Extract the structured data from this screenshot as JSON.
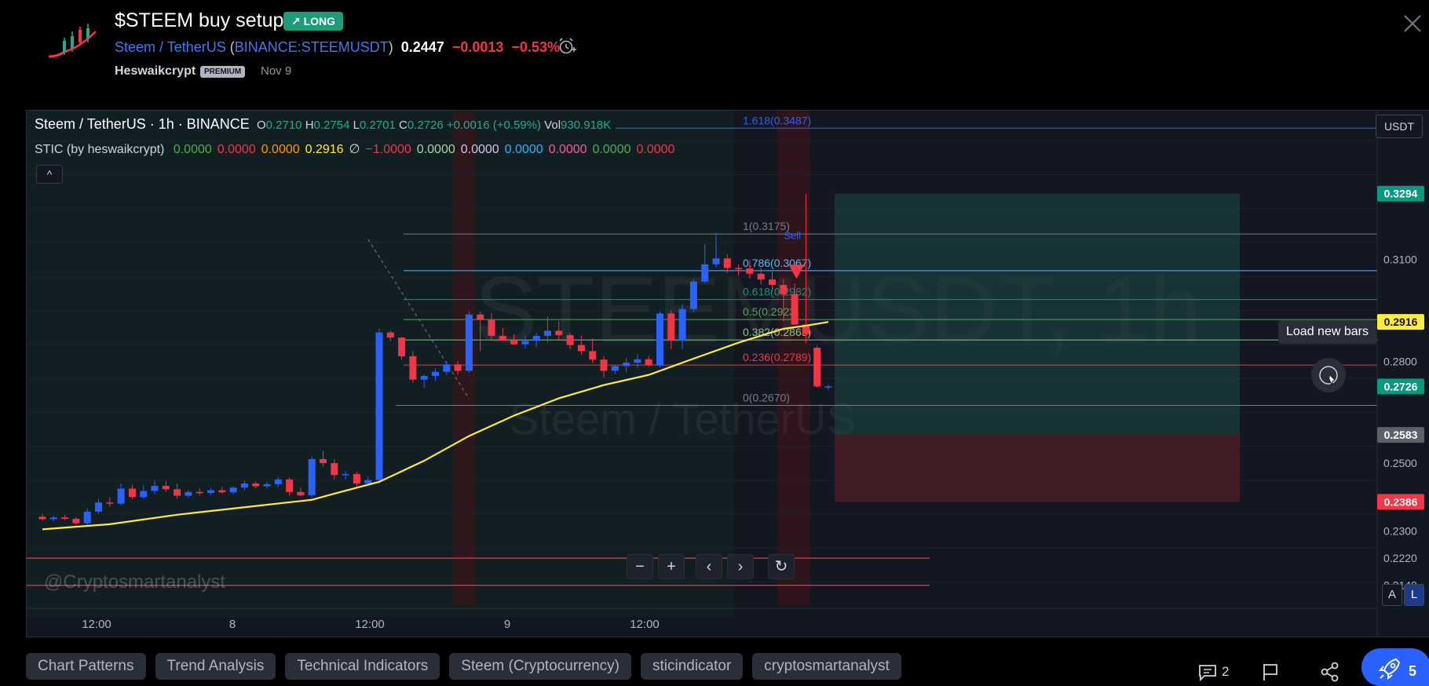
{
  "idea": {
    "title": "$STEEM buy setup",
    "badge": "↗ LONG",
    "symbol_name": "Steem / TetherUS",
    "paren_open": " (",
    "exchange_symbol": "BINANCE:STEEMUSDT",
    "paren_close": ")",
    "last_price": "0.2447",
    "change": "−0.0013",
    "change_pct": "−0.53%",
    "author": "Heswaikcrypt",
    "premium": "PREMIUM",
    "date": "Nov 9"
  },
  "legend": {
    "title": "Steem / TetherUS · 1h · BINANCE",
    "o_label": "O",
    "o_value": "0.2710",
    "h_label": "H",
    "h_value": "0.2754",
    "l_label": "L",
    "l_value": "0.2701",
    "c_label": "C",
    "c_value": "0.2726",
    "change": "+0.0016 (+0.59%)",
    "vol_label": "Vol",
    "vol_value": "930.918K",
    "indicator_name": "STIC (by heswaikcrypt)",
    "indicator_values": [
      {
        "text": "0.0000",
        "color": "#4caf50"
      },
      {
        "text": "0.0000",
        "color": "#f23645"
      },
      {
        "text": "0.0000",
        "color": "#ff9800"
      },
      {
        "text": "0.2916",
        "color": "#ffeb3b"
      },
      {
        "text": "∅",
        "color": "#d1d4dc"
      },
      {
        "text": "−1.0000",
        "color": "#f23645"
      },
      {
        "text": "0.0000",
        "color": "#a5d6a7"
      },
      {
        "text": "0.0000",
        "color": "#e1bee7"
      },
      {
        "text": "0.0000",
        "color": "#29b6f6"
      },
      {
        "text": "0.0000",
        "color": "#f06292"
      },
      {
        "text": "0.0000",
        "color": "#4caf50"
      },
      {
        "text": "0.0000",
        "color": "#f23645"
      }
    ],
    "collapse": "^"
  },
  "watermark": {
    "ticker": "STEEMUSDT, 1h",
    "name": "Steem / TetherUS",
    "handle": "@Cryptosmartanalyst"
  },
  "controls": {
    "zoom_out": "−",
    "zoom_in": "+",
    "scroll_left": "‹",
    "scroll_right": "›",
    "reset": "↻",
    "load_new_bars": "Load new bars",
    "axis_unit": "USDT",
    "auto": "A",
    "log": "L"
  },
  "tags": [
    "Chart Patterns",
    "Trend Analysis",
    "Technical Indicators",
    "Steem (Cryptocurrency)",
    "sticindicator",
    "cryptosmartanalyst"
  ],
  "footer": {
    "comments": "2",
    "boosts": "5"
  },
  "colors": {
    "bull": "#2962ff",
    "bear": "#f23645",
    "ema": "#ffeb3b",
    "accent": "#2962ff",
    "long_badge": "#1e9c79"
  },
  "chart_data": {
    "type": "candlestick",
    "symbol": "STEEMUSDT",
    "interval": "1h",
    "exchange": "BINANCE",
    "x_tick_labels": [
      "12:00",
      "8",
      "12:00",
      "9",
      "12:00"
    ],
    "y_tick_labels": [
      "0.3100",
      "0.2800",
      "0.2500",
      "0.2300",
      "0.2220",
      "0.2140"
    ],
    "ylim": [
      0.207,
      0.352
    ],
    "price_labels": [
      {
        "text": "0.3294",
        "value": 0.3294,
        "bg": "#089981"
      },
      {
        "text": "0.2916",
        "value": 0.2916,
        "bg": "#ffeb3b"
      },
      {
        "text": "0.2726",
        "value": 0.2726,
        "bg": "#089981"
      },
      {
        "text": "0.2583",
        "value": 0.2583,
        "bg": "#5d606b"
      },
      {
        "text": "0.2386",
        "value": 0.2386,
        "bg": "#f23645"
      }
    ],
    "candles": [
      [
        0.2342,
        0.235,
        0.233,
        0.2335
      ],
      [
        0.2335,
        0.2345,
        0.2328,
        0.234
      ],
      [
        0.234,
        0.2348,
        0.2332,
        0.2336
      ],
      [
        0.2336,
        0.2341,
        0.2318,
        0.2323
      ],
      [
        0.2323,
        0.2367,
        0.2318,
        0.2357
      ],
      [
        0.2357,
        0.2395,
        0.235,
        0.2384
      ],
      [
        0.2384,
        0.24,
        0.2372,
        0.2381
      ],
      [
        0.2381,
        0.244,
        0.2375,
        0.2425
      ],
      [
        0.2425,
        0.2436,
        0.2394,
        0.24
      ],
      [
        0.24,
        0.2435,
        0.2395,
        0.2418
      ],
      [
        0.2418,
        0.245,
        0.2408,
        0.2433
      ],
      [
        0.2433,
        0.2447,
        0.2415,
        0.2423
      ],
      [
        0.2423,
        0.244,
        0.2395,
        0.2404
      ],
      [
        0.2404,
        0.242,
        0.2398,
        0.2415
      ],
      [
        0.2415,
        0.2425,
        0.2405,
        0.2412
      ],
      [
        0.2412,
        0.2426,
        0.2406,
        0.242
      ],
      [
        0.242,
        0.243,
        0.241,
        0.2414
      ],
      [
        0.2414,
        0.2432,
        0.2408,
        0.2428
      ],
      [
        0.2428,
        0.2448,
        0.242,
        0.244
      ],
      [
        0.244,
        0.2446,
        0.2426,
        0.2432
      ],
      [
        0.2432,
        0.2445,
        0.2425,
        0.2438
      ],
      [
        0.2438,
        0.246,
        0.243,
        0.2452
      ],
      [
        0.2452,
        0.2458,
        0.2405,
        0.2415
      ],
      [
        0.2415,
        0.2428,
        0.2402,
        0.2405
      ],
      [
        0.2405,
        0.252,
        0.2398,
        0.2512
      ],
      [
        0.2512,
        0.2537,
        0.249,
        0.25
      ],
      [
        0.25,
        0.2512,
        0.2452,
        0.2465
      ],
      [
        0.2465,
        0.2478,
        0.2452,
        0.2468
      ],
      [
        0.2468,
        0.2475,
        0.243,
        0.244
      ],
      [
        0.244,
        0.246,
        0.2435,
        0.245
      ],
      [
        0.245,
        0.2896,
        0.244,
        0.2885
      ],
      [
        0.2885,
        0.289,
        0.286,
        0.287
      ],
      [
        0.287,
        0.2872,
        0.2805,
        0.2815
      ],
      [
        0.2815,
        0.283,
        0.2736,
        0.2746
      ],
      [
        0.2746,
        0.2762,
        0.2722,
        0.2757
      ],
      [
        0.2757,
        0.278,
        0.2742,
        0.2769
      ],
      [
        0.2769,
        0.28,
        0.276,
        0.2791
      ],
      [
        0.2791,
        0.28,
        0.276,
        0.2772
      ],
      [
        0.2772,
        0.2948,
        0.2766,
        0.2938
      ],
      [
        0.2938,
        0.2946,
        0.283,
        0.2923
      ],
      [
        0.2923,
        0.2942,
        0.2865,
        0.2875
      ],
      [
        0.2875,
        0.2898,
        0.286,
        0.2863
      ],
      [
        0.2863,
        0.288,
        0.2848,
        0.285
      ],
      [
        0.285,
        0.2875,
        0.2838,
        0.286
      ],
      [
        0.286,
        0.2885,
        0.2842,
        0.2875
      ],
      [
        0.2875,
        0.2932,
        0.2855,
        0.289
      ],
      [
        0.289,
        0.2918,
        0.286,
        0.2877
      ],
      [
        0.2877,
        0.2885,
        0.2836,
        0.2848
      ],
      [
        0.2848,
        0.2876,
        0.282,
        0.283
      ],
      [
        0.283,
        0.2868,
        0.2795,
        0.2805
      ],
      [
        0.2805,
        0.2815,
        0.2752,
        0.2772
      ],
      [
        0.2772,
        0.279,
        0.2763,
        0.2786
      ],
      [
        0.2786,
        0.281,
        0.2768,
        0.2796
      ],
      [
        0.2796,
        0.2822,
        0.2781,
        0.2806
      ],
      [
        0.2806,
        0.2816,
        0.2784,
        0.2789
      ],
      [
        0.2789,
        0.2948,
        0.2782,
        0.2941
      ],
      [
        0.2941,
        0.295,
        0.2836,
        0.2861
      ],
      [
        0.2861,
        0.2968,
        0.2836,
        0.2954
      ],
      [
        0.2954,
        0.3042,
        0.2945,
        0.3035
      ],
      [
        0.3035,
        0.3146,
        0.303,
        0.3086
      ],
      [
        0.3086,
        0.3178,
        0.3076,
        0.3103
      ],
      [
        0.3103,
        0.3115,
        0.306,
        0.3075
      ],
      [
        0.3075,
        0.3085,
        0.3052,
        0.3074
      ],
      [
        0.3074,
        0.3098,
        0.3044,
        0.3058
      ],
      [
        0.3058,
        0.3075,
        0.3026,
        0.3041
      ],
      [
        0.3041,
        0.3064,
        0.3005,
        0.3025
      ],
      [
        0.3025,
        0.3042,
        0.2918,
        0.2998
      ],
      [
        0.2998,
        0.3029,
        0.2968,
        0.2908
      ],
      [
        0.2908,
        0.3294,
        0.2854,
        0.288
      ],
      [
        0.284,
        0.2846,
        0.2722,
        0.2726
      ],
      [
        0.2726,
        0.273,
        0.2716,
        0.2726
      ]
    ],
    "ema": [
      [
        0,
        0.2305
      ],
      [
        6,
        0.232
      ],
      [
        12,
        0.2348
      ],
      [
        18,
        0.237
      ],
      [
        24,
        0.2392
      ],
      [
        26,
        0.241
      ],
      [
        30,
        0.2445
      ],
      [
        34,
        0.2507
      ],
      [
        38,
        0.258
      ],
      [
        42,
        0.264
      ],
      [
        46,
        0.2691
      ],
      [
        50,
        0.273
      ],
      [
        54,
        0.276
      ],
      [
        58,
        0.2808
      ],
      [
        62,
        0.2855
      ],
      [
        66,
        0.2896
      ],
      [
        68,
        0.2905
      ],
      [
        70,
        0.2916
      ]
    ],
    "fib_levels": [
      {
        "label": "1.618(0.3487)",
        "value": 0.3487,
        "color": "#2962ff"
      },
      {
        "label": "1(0.3175)",
        "value": 0.3175,
        "color": "#787b86"
      },
      {
        "label": "0.786(0.3067)",
        "value": 0.3067,
        "color": "#64b5f6"
      },
      {
        "label": "0.618(0.2982)",
        "value": 0.2982,
        "color": "#089981"
      },
      {
        "label": "0.5(0.2923)",
        "value": 0.2923,
        "color": "#4caf50"
      },
      {
        "label": "0.382(0.2863)",
        "value": 0.2863,
        "color": "#81c784"
      },
      {
        "label": "0.236(0.2789)",
        "value": 0.2789,
        "color": "#f23645"
      },
      {
        "label": "0(0.2670)",
        "value": 0.267,
        "color": "#787b86"
      }
    ],
    "support_lines": [
      0.222,
      0.214
    ],
    "position": {
      "type": "short",
      "entry": 0.2583,
      "target": 0.2386,
      "stop": 0.3294
    },
    "signal": {
      "label": "Sell",
      "candle_index": 68
    }
  }
}
